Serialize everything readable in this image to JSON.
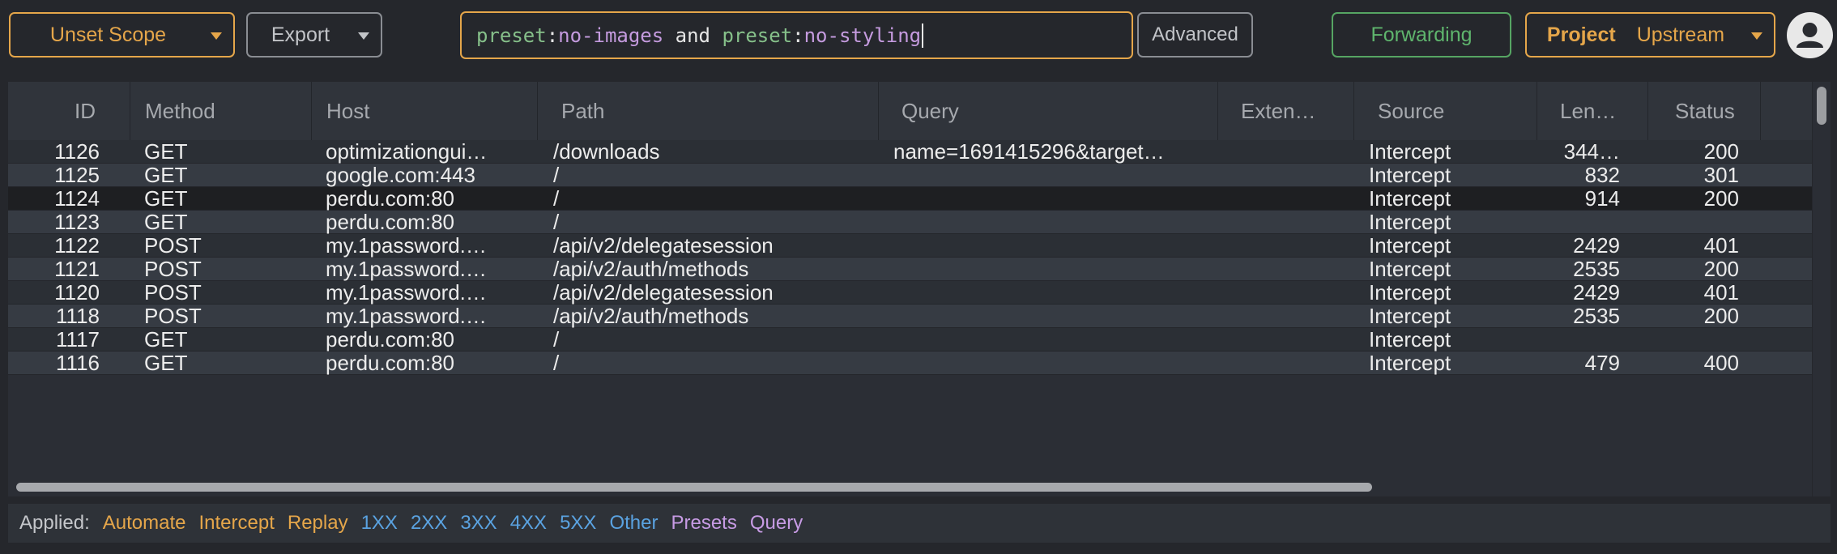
{
  "toolbar": {
    "scope_label": "Unset Scope",
    "export_label": "Export",
    "advanced_label": "Advanced",
    "forwarding_label": "Forwarding",
    "project_label": "Project",
    "upstream_label": "Upstream"
  },
  "search": {
    "tokens": [
      {
        "text": "preset",
        "kind": "key"
      },
      {
        "text": ":",
        "kind": "op"
      },
      {
        "text": "no-images",
        "kind": "val"
      },
      {
        "text": " and ",
        "kind": "op"
      },
      {
        "text": "preset",
        "kind": "key"
      },
      {
        "text": ":",
        "kind": "op"
      },
      {
        "text": "no-styling",
        "kind": "val"
      }
    ]
  },
  "table": {
    "columns": [
      "ID",
      "Method",
      "Host",
      "Path",
      "Query",
      "Exten…",
      "Source",
      "Len…",
      "Status"
    ],
    "rows": [
      {
        "id": "1126",
        "method": "GET",
        "host": "optimizationgui…",
        "path": "/downloads",
        "query": "name=1691415296&target…",
        "ext": "",
        "source": "Intercept",
        "length": "344…",
        "status": "200"
      },
      {
        "id": "1125",
        "method": "GET",
        "host": "google.com:443",
        "path": "/",
        "query": "",
        "ext": "",
        "source": "Intercept",
        "length": "832",
        "status": "301"
      },
      {
        "id": "1124",
        "method": "GET",
        "host": "perdu.com:80",
        "path": "/",
        "query": "",
        "ext": "",
        "source": "Intercept",
        "length": "914",
        "status": "200"
      },
      {
        "id": "1123",
        "method": "GET",
        "host": "perdu.com:80",
        "path": "/",
        "query": "",
        "ext": "",
        "source": "Intercept",
        "length": "",
        "status": ""
      },
      {
        "id": "1122",
        "method": "POST",
        "host": "my.1password.…",
        "path": "/api/v2/delegatesession",
        "query": "",
        "ext": "",
        "source": "Intercept",
        "length": "2429",
        "status": "401"
      },
      {
        "id": "1121",
        "method": "POST",
        "host": "my.1password.…",
        "path": "/api/v2/auth/methods",
        "query": "",
        "ext": "",
        "source": "Intercept",
        "length": "2535",
        "status": "200"
      },
      {
        "id": "1120",
        "method": "POST",
        "host": "my.1password.…",
        "path": "/api/v2/delegatesession",
        "query": "",
        "ext": "",
        "source": "Intercept",
        "length": "2429",
        "status": "401"
      },
      {
        "id": "1118",
        "method": "POST",
        "host": "my.1password.…",
        "path": "/api/v2/auth/methods",
        "query": "",
        "ext": "",
        "source": "Intercept",
        "length": "2535",
        "status": "200"
      },
      {
        "id": "1117",
        "method": "GET",
        "host": "perdu.com:80",
        "path": "/",
        "query": "",
        "ext": "",
        "source": "Intercept",
        "length": "",
        "status": ""
      },
      {
        "id": "1116",
        "method": "GET",
        "host": "perdu.com:80",
        "path": "/",
        "query": "",
        "ext": "",
        "source": "Intercept",
        "length": "479",
        "status": "400"
      }
    ],
    "selected_row_index": 2
  },
  "footer": {
    "applied_label": "Applied:",
    "filters": [
      {
        "text": "Automate",
        "color": "orange"
      },
      {
        "text": "Intercept",
        "color": "orange"
      },
      {
        "text": "Replay",
        "color": "orange"
      },
      {
        "text": "1XX",
        "color": "blue"
      },
      {
        "text": "2XX",
        "color": "blue"
      },
      {
        "text": "3XX",
        "color": "blue"
      },
      {
        "text": "4XX",
        "color": "blue"
      },
      {
        "text": "5XX",
        "color": "blue"
      },
      {
        "text": "Other",
        "color": "blue"
      },
      {
        "text": "Presets",
        "color": "purple"
      },
      {
        "text": "Query",
        "color": "purple"
      }
    ]
  },
  "colors": {
    "accent_orange": "#e5a64a",
    "accent_green": "#5fb56d",
    "accent_blue": "#5aa2e0",
    "accent_purple": "#c79be4",
    "background": "#25272c"
  },
  "icons": {
    "avatar": "user-avatar-icon",
    "dropdown": "chevron-down-icon"
  }
}
